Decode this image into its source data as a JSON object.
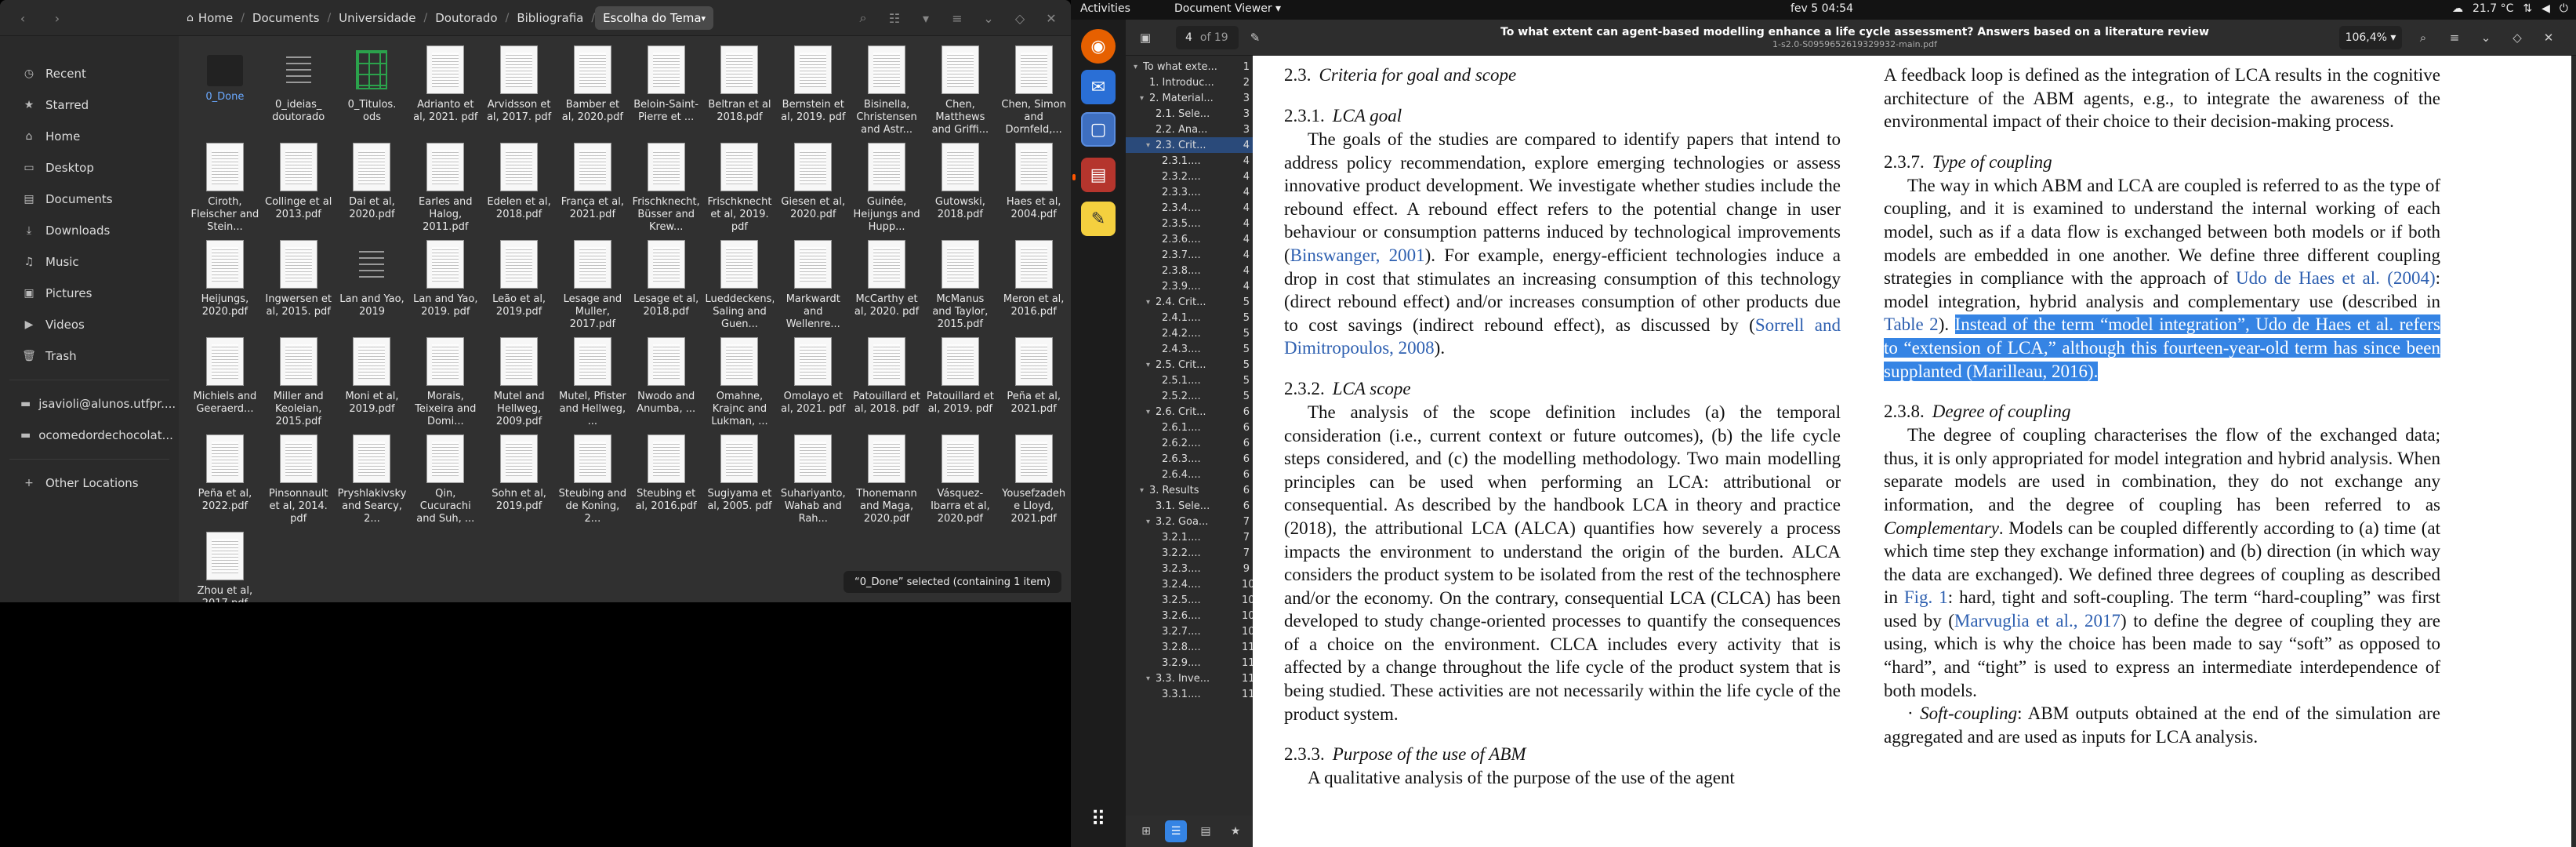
{
  "files": {
    "path": [
      {
        "label": "Home",
        "icon": "home-icon"
      },
      {
        "label": "Documents"
      },
      {
        "label": "Universidade"
      },
      {
        "label": "Doutorado"
      },
      {
        "label": "Bibliografia"
      },
      {
        "label": "Escolha do Tema",
        "active": true
      }
    ],
    "sidebar": [
      {
        "label": "Recent",
        "icon": "◷"
      },
      {
        "label": "Starred",
        "icon": "★"
      },
      {
        "label": "Home",
        "icon": "⌂"
      },
      {
        "label": "Desktop",
        "icon": "▭"
      },
      {
        "label": "Documents",
        "icon": "▤"
      },
      {
        "label": "Downloads",
        "icon": "⤓"
      },
      {
        "label": "Music",
        "icon": "♫"
      },
      {
        "label": "Pictures",
        "icon": "▣"
      },
      {
        "label": "Videos",
        "icon": "▶"
      },
      {
        "label": "Trash",
        "icon": "🗑"
      },
      {
        "label": "jsavioli@alunos.utfpr....",
        "icon": "▬",
        "sep_before": true
      },
      {
        "label": "ocomedordechocolat...",
        "icon": "▬"
      },
      {
        "label": "Other Locations",
        "icon": "+",
        "sep_before": true
      }
    ],
    "items": [
      {
        "name": "0_Done",
        "kind": "folder",
        "selected": true
      },
      {
        "name": "0_ideias_ doutorado",
        "kind": "doc"
      },
      {
        "name": "0_Titulos. ods",
        "kind": "ods"
      },
      {
        "name": "Adrianto et al, 2021. pdf",
        "kind": "pdf"
      },
      {
        "name": "Arvidsson et al, 2017. pdf",
        "kind": "pdf"
      },
      {
        "name": "Bamber et al, 2020.pdf",
        "kind": "pdf"
      },
      {
        "name": "Beloin-Saint-Pierre et ...",
        "kind": "pdf"
      },
      {
        "name": "Beltran et al 2018.pdf",
        "kind": "pdf"
      },
      {
        "name": "Bernstein et al, 2019. pdf",
        "kind": "pdf"
      },
      {
        "name": "Bisinella, Christensen and Astr...",
        "kind": "pdf"
      },
      {
        "name": "Chen, Matthews and Griffi...",
        "kind": "pdf"
      },
      {
        "name": "Chen, Simon and Dornfeld,...",
        "kind": "pdf"
      },
      {
        "name": "Ciroth, Fleischer and Stein...",
        "kind": "pdf"
      },
      {
        "name": "Collinge et al 2013.pdf",
        "kind": "pdf"
      },
      {
        "name": "Dai et al, 2020.pdf",
        "kind": "pdf"
      },
      {
        "name": "Earles and Halog, 2011.pdf",
        "kind": "pdf"
      },
      {
        "name": "Edelen et al, 2018.pdf",
        "kind": "pdf"
      },
      {
        "name": "França et al, 2021.pdf",
        "kind": "pdf"
      },
      {
        "name": "Frischknecht, Büsser and Krew...",
        "kind": "pdf"
      },
      {
        "name": "Frischknecht et al, 2019. pdf",
        "kind": "pdf"
      },
      {
        "name": "Giesen et al, 2020.pdf",
        "kind": "pdf"
      },
      {
        "name": "Guinée, Heijungs and Hupp...",
        "kind": "pdf"
      },
      {
        "name": "Gutowski, 2018.pdf",
        "kind": "pdf"
      },
      {
        "name": "Haes et al, 2004.pdf",
        "kind": "pdf"
      },
      {
        "name": "Heijungs, 2020.pdf",
        "kind": "pdf"
      },
      {
        "name": "Ingwersen et al, 2015. pdf",
        "kind": "pdf"
      },
      {
        "name": "Lan and Yao, 2019",
        "kind": "doc"
      },
      {
        "name": "Lan and Yao, 2019. pdf",
        "kind": "pdf"
      },
      {
        "name": "Leão et al, 2019.pdf",
        "kind": "pdf"
      },
      {
        "name": "Lesage and Muller, 2017.pdf",
        "kind": "pdf"
      },
      {
        "name": "Lesage et al, 2018.pdf",
        "kind": "pdf"
      },
      {
        "name": "Lueddeckens, Saling and Guen...",
        "kind": "pdf"
      },
      {
        "name": "Markwardt and Wellenre...",
        "kind": "pdf"
      },
      {
        "name": "McCarthy et al, 2020. pdf",
        "kind": "pdf"
      },
      {
        "name": "McManus and Taylor, 2015.pdf",
        "kind": "pdf"
      },
      {
        "name": "Meron et al, 2016.pdf",
        "kind": "pdf"
      },
      {
        "name": "Michiels and Geeraerd...",
        "kind": "pdf"
      },
      {
        "name": "Miller and Keoleian, 2015.pdf",
        "kind": "pdf"
      },
      {
        "name": "Moni et al, 2019.pdf",
        "kind": "pdf"
      },
      {
        "name": "Morais, Teixeira and Domi...",
        "kind": "pdf"
      },
      {
        "name": "Mutel and Hellweg, 2009.pdf",
        "kind": "pdf"
      },
      {
        "name": "Mutel, Pfister and Hellweg, ...",
        "kind": "pdf"
      },
      {
        "name": "Nwodo and Anumba, ...",
        "kind": "pdf"
      },
      {
        "name": "Omahne, Krajnc and Lukman, ...",
        "kind": "pdf"
      },
      {
        "name": "Omolayo et al, 2021. pdf",
        "kind": "pdf"
      },
      {
        "name": "Patouillard et al, 2018. pdf",
        "kind": "pdf"
      },
      {
        "name": "Patouillard et al, 2019. pdf",
        "kind": "pdf"
      },
      {
        "name": "Peña et al, 2021.pdf",
        "kind": "pdf"
      },
      {
        "name": "Peña et al, 2022.pdf",
        "kind": "pdf"
      },
      {
        "name": "Pinsonnault et al, 2014. pdf",
        "kind": "pdf"
      },
      {
        "name": "Pryshlakivsky and Searcy, 2...",
        "kind": "pdf"
      },
      {
        "name": "Qin, Cucurachi and Suh, ...",
        "kind": "pdf"
      },
      {
        "name": "Sohn et al, 2019.pdf",
        "kind": "pdf"
      },
      {
        "name": "Steubing and de Koning, 2...",
        "kind": "pdf"
      },
      {
        "name": "Steubing et al, 2016.pdf",
        "kind": "pdf"
      },
      {
        "name": "Sugiyama et al, 2005. pdf",
        "kind": "pdf"
      },
      {
        "name": "Suhariyanto, Wahab and Rah...",
        "kind": "pdf"
      },
      {
        "name": "Thonemann and Maga, 2020.pdf",
        "kind": "pdf"
      },
      {
        "name": "Vásquez-Ibarra et al, 2020.pdf",
        "kind": "pdf"
      },
      {
        "name": "Yousefzadeh e Lloyd, 2021.pdf",
        "kind": "pdf"
      },
      {
        "name": "Zhou et al, 2017.pdf",
        "kind": "pdf"
      }
    ],
    "status": "“0_Done” selected  (containing 1 item)"
  },
  "topbar": {
    "activities": "Activities",
    "app": "Document Viewer ▾",
    "clock": "fev 5  04:54",
    "temp": "21.7 °C"
  },
  "viewer": {
    "page_current": "4",
    "page_total": "of 19",
    "title": "To what extent can agent-based modelling enhance a life cycle assessment? Answers based on a literature review",
    "subtitle": "1-s2.0-S0959652619329932-main.pdf",
    "zoom": "106,4% ▾",
    "outline": [
      {
        "indent": 0,
        "tw": "▾",
        "label": "To what exte...",
        "page": "1"
      },
      {
        "indent": 1,
        "tw": "",
        "label": "1. Introduc...",
        "page": "2"
      },
      {
        "indent": 1,
        "tw": "▾",
        "label": "2. Material...",
        "page": "3"
      },
      {
        "indent": 2,
        "tw": "",
        "label": "2.1. Sele...",
        "page": "3"
      },
      {
        "indent": 2,
        "tw": "",
        "label": "2.2. Ana...",
        "page": "3"
      },
      {
        "indent": 2,
        "tw": "▾",
        "label": "2.3. Crit...",
        "page": "4",
        "selected": true
      },
      {
        "indent": 3,
        "tw": "",
        "label": "2.3.1....",
        "page": "4"
      },
      {
        "indent": 3,
        "tw": "",
        "label": "2.3.2....",
        "page": "4"
      },
      {
        "indent": 3,
        "tw": "",
        "label": "2.3.3....",
        "page": "4"
      },
      {
        "indent": 3,
        "tw": "",
        "label": "2.3.4....",
        "page": "4"
      },
      {
        "indent": 3,
        "tw": "",
        "label": "2.3.5....",
        "page": "4"
      },
      {
        "indent": 3,
        "tw": "",
        "label": "2.3.6....",
        "page": "4"
      },
      {
        "indent": 3,
        "tw": "",
        "label": "2.3.7....",
        "page": "4"
      },
      {
        "indent": 3,
        "tw": "",
        "label": "2.3.8....",
        "page": "4"
      },
      {
        "indent": 3,
        "tw": "",
        "label": "2.3.9....",
        "page": "4"
      },
      {
        "indent": 2,
        "tw": "▾",
        "label": "2.4. Crit...",
        "page": "5"
      },
      {
        "indent": 3,
        "tw": "",
        "label": "2.4.1....",
        "page": "5"
      },
      {
        "indent": 3,
        "tw": "",
        "label": "2.4.2....",
        "page": "5"
      },
      {
        "indent": 3,
        "tw": "",
        "label": "2.4.3....",
        "page": "5"
      },
      {
        "indent": 2,
        "tw": "▾",
        "label": "2.5. Crit...",
        "page": "5"
      },
      {
        "indent": 3,
        "tw": "",
        "label": "2.5.1....",
        "page": "5"
      },
      {
        "indent": 3,
        "tw": "",
        "label": "2.5.2....",
        "page": "5"
      },
      {
        "indent": 2,
        "tw": "▾",
        "label": "2.6. Crit...",
        "page": "6"
      },
      {
        "indent": 3,
        "tw": "",
        "label": "2.6.1....",
        "page": "6"
      },
      {
        "indent": 3,
        "tw": "",
        "label": "2.6.2....",
        "page": "6"
      },
      {
        "indent": 3,
        "tw": "",
        "label": "2.6.3....",
        "page": "6"
      },
      {
        "indent": 3,
        "tw": "",
        "label": "2.6.4....",
        "page": "6"
      },
      {
        "indent": 1,
        "tw": "▾",
        "label": "3. Results",
        "page": "6"
      },
      {
        "indent": 2,
        "tw": "",
        "label": "3.1. Sele...",
        "page": "6"
      },
      {
        "indent": 2,
        "tw": "▾",
        "label": "3.2. Goa...",
        "page": "7"
      },
      {
        "indent": 3,
        "tw": "",
        "label": "3.2.1....",
        "page": "7"
      },
      {
        "indent": 3,
        "tw": "",
        "label": "3.2.2....",
        "page": "7"
      },
      {
        "indent": 3,
        "tw": "",
        "label": "3.2.3....",
        "page": "9"
      },
      {
        "indent": 3,
        "tw": "",
        "label": "3.2.4....",
        "page": "10"
      },
      {
        "indent": 3,
        "tw": "",
        "label": "3.2.5....",
        "page": "10"
      },
      {
        "indent": 3,
        "tw": "",
        "label": "3.2.6....",
        "page": "10"
      },
      {
        "indent": 3,
        "tw": "",
        "label": "3.2.7....",
        "page": "10"
      },
      {
        "indent": 3,
        "tw": "",
        "label": "3.2.8....",
        "page": "11"
      },
      {
        "indent": 3,
        "tw": "",
        "label": "3.2.9....",
        "page": "11"
      },
      {
        "indent": 2,
        "tw": "▾",
        "label": "3.3. Inve...",
        "page": "11"
      },
      {
        "indent": 3,
        "tw": "",
        "label": "3.3.1....",
        "page": "11"
      }
    ]
  },
  "doc": {
    "c1_h1_num": "2.3.",
    "c1_h1": "Criteria for goal and scope",
    "c1_h2_num": "2.3.1.",
    "c1_h2": "LCA goal",
    "c1_p1a": "The goals of the studies are compared to identify papers that intend to address policy recommendation, explore emerging technologies or assess innovative product development. We investigate whether studies include the rebound effect. A rebound effect refers to the potential change in user behaviour or consumption patterns induced by technological improvements (",
    "c1_p1_link1": "Binswanger, 2001",
    "c1_p1b": "). For example, energy-efficient technologies induce a drop in cost that stimulates an increasing consumption of this technology (direct rebound effect) and/or increases consumption of other products due to cost savings (indirect rebound effect), as discussed by (",
    "c1_p1_link2": "Sorrell and Dimitropoulos, 2008",
    "c1_p1c": ").",
    "c1_h3_num": "2.3.2.",
    "c1_h3": "LCA scope",
    "c1_p2": "The analysis of the scope definition includes (a) the temporal consideration (i.e., current context or future outcomes), (b) the life cycle steps considered, and (c) the modelling methodology. Two main modelling principles can be used when performing an LCA: attributional or consequential. As described by the handbook LCA in theory and practice (2018), the attributional LCA (ALCA) quantifies how severely a process impacts the environment to understand the origin of the burden. ALCA considers the product system to be isolated from the rest of the technosphere and/or the economy. On the contrary, consequential LCA (CLCA) has been developed to study change-oriented processes to quantify the consequences of a choice on the environment. CLCA includes every activity that is affected by a change throughout the life cycle of the product system that is being studied. These activities are not necessarily within the life cycle of the product system.",
    "c1_h4_num": "2.3.3.",
    "c1_h4": "Purpose of the use of ABM",
    "c1_p3": "A qualitative analysis of the purpose of the use of the agent",
    "c2_p0": "A feedback loop is defined as the integration of LCA results in the cognitive architecture of the ABM agents, e.g., to integrate the awareness of the environmental impact of their choice to their decision-making process.",
    "c2_h1_num": "2.3.7.",
    "c2_h1": "Type of coupling",
    "c2_p1a": "The way in which ABM and LCA are coupled is referred to as the type of coupling, and it is examined to understand the internal working of each model, such as if a data flow is exchanged between both models or if both models are embedded in one another. We define three different coupling strategies in compliance with the approach of ",
    "c2_p1_link1": "Udo de Haes et al. (2004)",
    "c2_p1b": ": model integration, hybrid analysis and complementary use (described in ",
    "c2_p1_link2": "Table 2",
    "c2_p1c": "). ",
    "c2_p1_hl": "Instead of the term “model integration”, Udo de Haes et al. refers to “extension of LCA,” although this fourteen-year-old term has since been supplanted (Marilleau, 2016).",
    "c2_h2_num": "2.3.8.",
    "c2_h2": "Degree of coupling",
    "c2_p2a": "The degree of coupling characterises the flow of the exchanged data; thus, it is only appropriated for model integration and hybrid analysis. When separate models are used in combination, they do not exchange any information, and the degree of coupling has been referred to as ",
    "c2_p2_em": "Complementary",
    "c2_p2b": ". Models can be coupled differently according to (a) time (at which time step they exchange information) and (b) direction (in which way the data are exchanged). We defined three degrees of coupling as described in ",
    "c2_p2_link1": "Fig. 1",
    "c2_p2c": ": hard, tight and soft-coupling. The term “hard-coupling” was first used by (",
    "c2_p2_link2": "Marvuglia et al., 2017",
    "c2_p2d": ") to define the degree of coupling they are using, which is why the choice has been made to say “soft” as opposed to “hard”, and “tight” is used to express an intermediate interdependence of both models.",
    "c2_p3_em": "Soft-coupling",
    "c2_p3": ": ABM outputs obtained at the end of the simulation are aggregated and are used as inputs for LCA analysis."
  }
}
